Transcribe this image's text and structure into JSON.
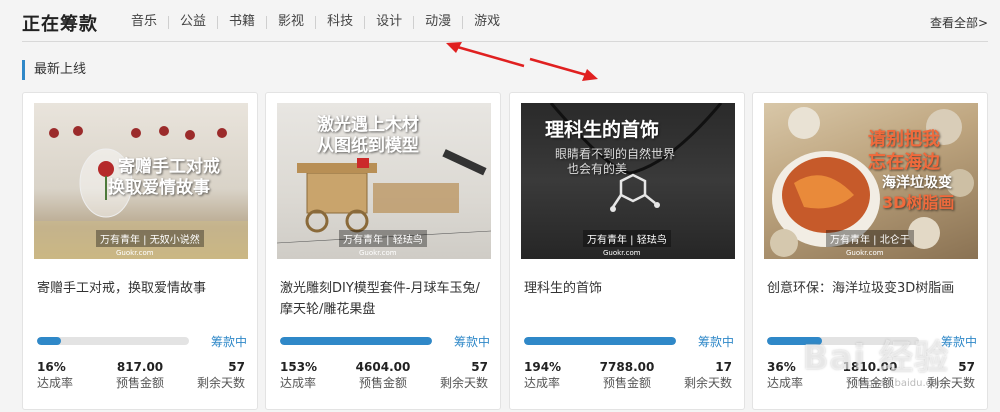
{
  "header": {
    "title": "正在筹款",
    "nav": [
      "音乐",
      "公益",
      "书籍",
      "影视",
      "科技",
      "设计",
      "动漫",
      "游戏"
    ],
    "view_all": "查看全部>"
  },
  "section": {
    "title": "最新上线"
  },
  "colors": {
    "accent": "#2f88c8",
    "arrow": "#e02020",
    "bar_track": "#e3e3e3"
  },
  "labels": {
    "rate": "达成率",
    "amount": "预售金额",
    "days": "剩余天数"
  },
  "cards": [
    {
      "title": "寄赠手工对戒，换取爱情故事",
      "image_text": [
        "寄赠手工对戒",
        "换取爱情故事"
      ],
      "brand": "万有青年 | 无奴小说然",
      "brand_sub": "Guokr.com",
      "status": "筹款中",
      "progress": 0.16,
      "rate": "16%",
      "amount": "817.00",
      "days": "57"
    },
    {
      "title": "激光雕刻DIY模型套件-月球车玉兔/摩天轮/雕花果盘",
      "image_text": [
        "激光遇上木材",
        "从图纸到模型"
      ],
      "brand": "万有青年 | 轻珐鸟",
      "brand_sub": "Guokr.com",
      "status": "筹款中",
      "progress": 1.0,
      "rate": "153%",
      "amount": "4604.00",
      "days": "57"
    },
    {
      "title": "理科生的首饰",
      "image_text": [
        "理科生的首饰",
        "眼睛看不到的自然世界",
        "也会有的美"
      ],
      "brand": "万有青年 | 轻珐鸟",
      "brand_sub": "Guokr.com",
      "status": "筹款中",
      "progress": 1.0,
      "rate": "194%",
      "amount": "7788.00",
      "days": "17"
    },
    {
      "title": "创意环保：海洋垃圾变3D树脂画",
      "image_text": [
        "请别把我",
        "忘在海边",
        "海洋垃圾变",
        "3D树脂画"
      ],
      "brand": "万有青年 | 北仑于",
      "brand_sub": "Guokr.com",
      "status": "筹款中",
      "progress": 0.36,
      "rate": "36%",
      "amount": "1810.00",
      "days": "57"
    }
  ],
  "watermark": {
    "text": "Bai 经验",
    "sub": "jingyan.baidu.com"
  }
}
